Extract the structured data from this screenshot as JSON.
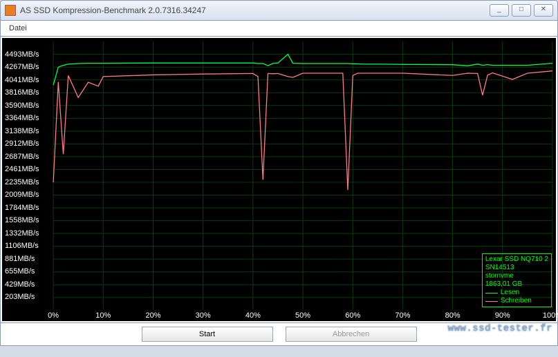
{
  "window": {
    "title": "AS SSD Kompression-Benchmark 2.0.7316.34247",
    "min": "_",
    "max": "□",
    "close": "✕"
  },
  "menu": {
    "datei": "Datei"
  },
  "legend": {
    "device": "Lexar SSD NQ710 2",
    "sn": "SN14513",
    "driver": "stornvme",
    "size": "1863,01 GB",
    "read": "Lesen",
    "write": "Schreiben"
  },
  "buttons": {
    "start": "Start",
    "abort": "Abbrechen"
  },
  "watermark": "www.ssd-tester.fr",
  "yTicks": [
    203,
    429,
    655,
    881,
    1106,
    1332,
    1558,
    1784,
    2009,
    2235,
    2461,
    2687,
    2912,
    3138,
    3364,
    3590,
    3816,
    4041,
    4267,
    4493
  ],
  "yUnit": "MB/s",
  "xTicks": [
    0,
    10,
    20,
    30,
    40,
    50,
    60,
    70,
    80,
    90,
    100
  ],
  "xUnit": "%",
  "chart_data": {
    "type": "line",
    "xlabel": "",
    "ylabel": "",
    "title": "",
    "x": [
      0,
      1,
      2,
      3,
      5,
      7,
      9,
      10,
      20,
      30,
      40,
      41,
      42,
      43,
      44,
      45,
      47,
      48,
      50,
      58,
      59,
      60,
      61,
      62,
      65,
      70,
      80,
      83,
      85,
      86,
      87,
      88,
      92,
      95,
      100
    ],
    "series": [
      {
        "name": "Lesen",
        "color": "#00ff44",
        "values": [
          3950,
          4267,
          4300,
          4320,
          4330,
          4335,
          4335,
          4335,
          4340,
          4340,
          4340,
          4330,
          4330,
          4293,
          4332,
          4340,
          4493,
          4335,
          4330,
          4330,
          4330,
          4325,
          4325,
          4320,
          4320,
          4315,
          4310,
          4290,
          4320,
          4300,
          4310,
          4300,
          4300,
          4300,
          4335
        ]
      },
      {
        "name": "Schreiben",
        "color": "#ff7a8a",
        "values": [
          2235,
          4005,
          2730,
          4118,
          3730,
          4000,
          3930,
          4100,
          4130,
          4145,
          4155,
          4100,
          2280,
          4155,
          4150,
          4155,
          4100,
          4085,
          4160,
          4160,
          2100,
          4120,
          4160,
          4160,
          4160,
          4160,
          4120,
          4160,
          4155,
          3770,
          4125,
          4165,
          4050,
          4160,
          4200
        ]
      }
    ],
    "ylim": [
      0,
      4720
    ],
    "xlim": [
      0,
      100
    ]
  }
}
